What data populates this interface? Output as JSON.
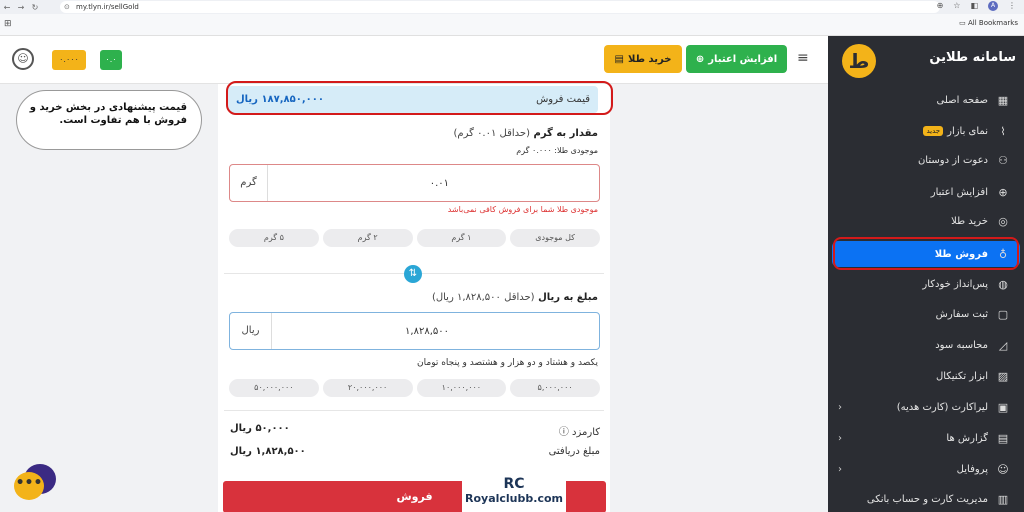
{
  "browser": {
    "url": "my.tlyn.ir/sellGold",
    "all_bookmarks": "All Bookmarks",
    "profile_initial": "A"
  },
  "header": {
    "gold_badge": "۰.۰۰۰",
    "green_badge": "۰.۰",
    "credit_button": "افزایش اعتبار",
    "buy_gold_button": "خرید طلا"
  },
  "sidebar": {
    "title": "سامانه طلاین",
    "logo_text": "ط",
    "new_badge": "جدید",
    "items": [
      {
        "label": "صفحه اصلی",
        "icon": "grid-icon"
      },
      {
        "label": "نمای بازار",
        "icon": "chart-icon"
      },
      {
        "label": "دعوت از دوستان",
        "icon": "users-icon"
      },
      {
        "label": "افزایش اعتبار",
        "icon": "plus-circle-icon"
      },
      {
        "label": "خرید طلا",
        "icon": "coins-icon"
      },
      {
        "label": "فروش طلا",
        "icon": "money-bag-icon"
      },
      {
        "label": "پس‌انداز خودکار",
        "icon": "piggy-icon"
      },
      {
        "label": "ثبت سفارش",
        "icon": "clipboard-icon"
      },
      {
        "label": "محاسبه سود",
        "icon": "area-chart-icon"
      },
      {
        "label": "ابزار تکنیکال",
        "icon": "line-chart-icon"
      },
      {
        "label": "لیراکارت (کارت هدیه)",
        "icon": "gift-icon"
      },
      {
        "label": "گزارش ها",
        "icon": "report-icon"
      },
      {
        "label": "پروفایل",
        "icon": "user-icon"
      },
      {
        "label": "مدیریت کارت و حساب بانکی",
        "icon": "bank-card-icon"
      }
    ]
  },
  "main": {
    "price_label": "قیمت فروش",
    "price_value": "۱۸۷,۸۵۰,۰۰۰ ریال",
    "gram_title": "مقدار به گرم",
    "gram_min": "(حداقل ۰.۰۱ گرم)",
    "gold_balance": "موجودی طلا: ۰.۰۰۰ گرم",
    "gram_value": "۰.۰۱",
    "gram_unit": "گرم",
    "error": "موجودی طلا شما برای فروش کافی نمی‌باشد",
    "gram_chips": [
      "کل موجودی",
      "۱ گرم",
      "۲ گرم",
      "۵ گرم"
    ],
    "rial_title": "مبلغ به ریال",
    "rial_min": "(حداقل ۱,۸۲۸,۵۰۰ ریال)",
    "rial_value": "۱,۸۲۸,۵۰۰",
    "rial_unit": "ریال",
    "amount_words": "یکصد و هشتاد و دو هزار و هشتصد و پنجاه تومان",
    "rial_chips": [
      "۵,۰۰۰,۰۰۰",
      "۱۰,۰۰۰,۰۰۰",
      "۲۰,۰۰۰,۰۰۰",
      "۵۰,۰۰۰,۰۰۰"
    ],
    "fee_label": "کارمزد",
    "fee_value": "۵۰,۰۰۰ ریال",
    "received_label": "مبلغ دریافتی",
    "received_value": "۱,۸۲۸,۵۰۰ ریال",
    "sell_button": "فروش"
  },
  "callout": {
    "text": "قیمت پیشنهادی در بخش خرید و فروش با هم تفاوت است."
  },
  "watermark": {
    "mark": "RC",
    "text": "Royalclubb.com"
  }
}
